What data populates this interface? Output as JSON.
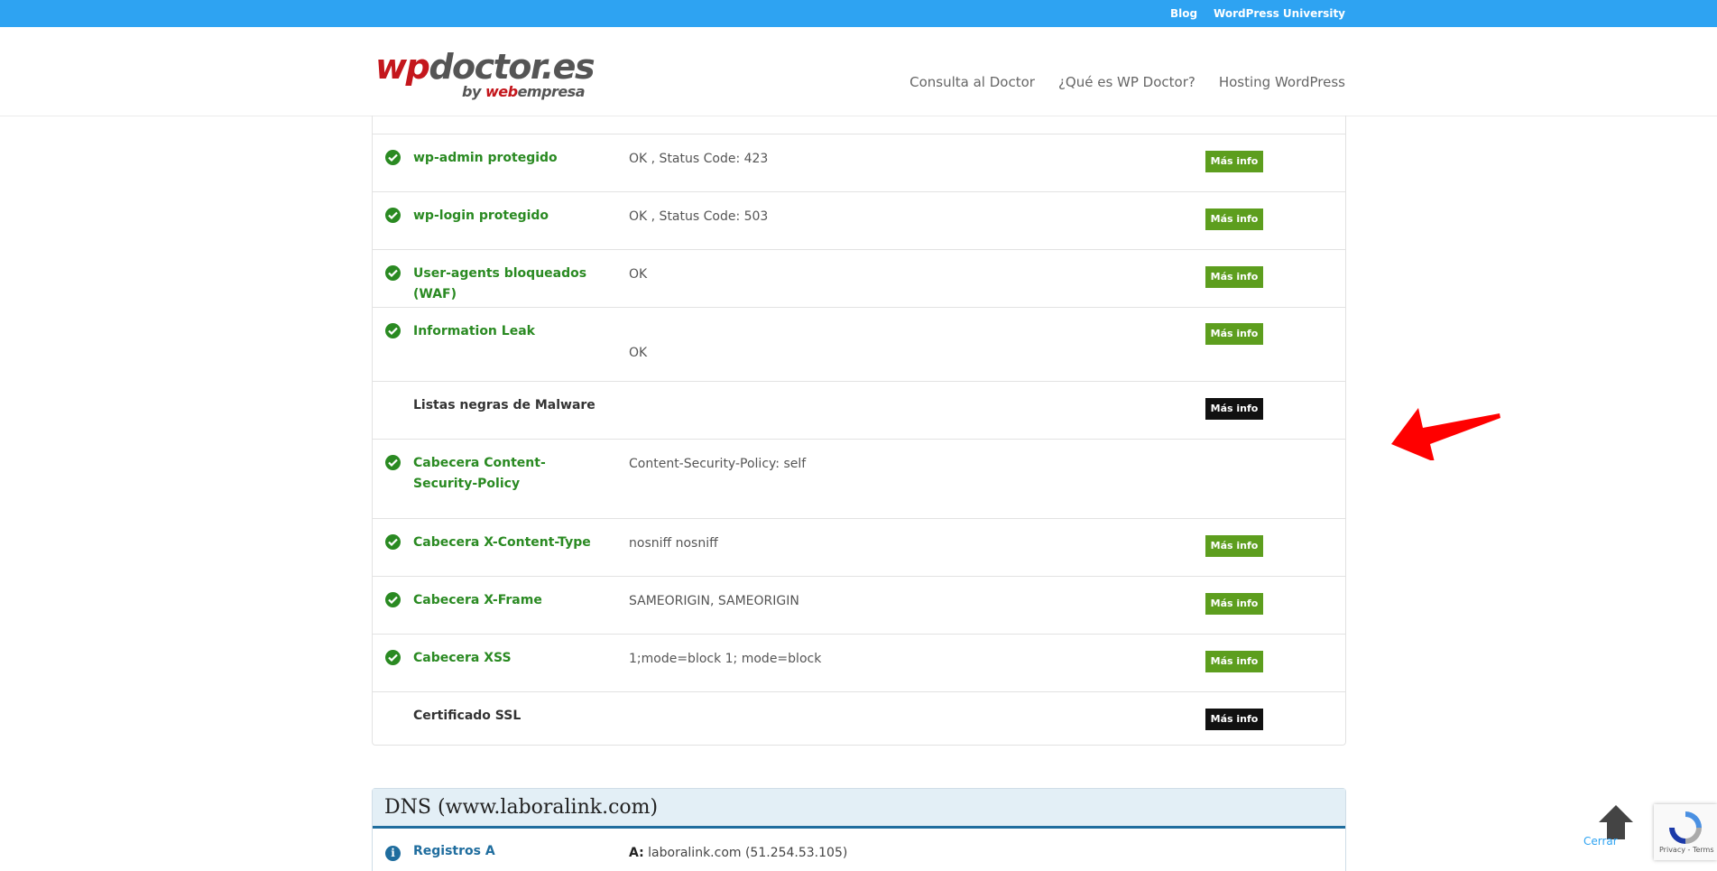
{
  "topbar": {
    "links": [
      "Blog",
      "WordPress University"
    ]
  },
  "logo": {
    "text_wp": "wp",
    "text_doctor": "doctor.es",
    "by": "by",
    "web": "web",
    "empresa": "empresa"
  },
  "nav": [
    "Consulta al Doctor",
    "¿Qué es WP Doctor?",
    "Hosting WordPress"
  ],
  "checks": [
    {
      "label": "wp-admin protegido",
      "status": "ok",
      "value": "OK , Status Code: 423",
      "button": "Más info"
    },
    {
      "label": "wp-login protegido",
      "status": "ok",
      "value": "OK , Status Code: 503",
      "button": "Más info"
    },
    {
      "label": "User-agents bloqueados (WAF)",
      "status": "ok",
      "value": "OK",
      "button": "Más info"
    },
    {
      "label": "Information Leak",
      "status": "ok",
      "value": "OK",
      "button": "Más info"
    },
    {
      "label": "Listas negras de Malware",
      "status": "none",
      "value": "",
      "button": "Más info"
    },
    {
      "label": "Cabecera Content-Security-Policy",
      "status": "ok",
      "value": "Content-Security-Policy: self",
      "button": ""
    },
    {
      "label": "Cabecera X-Content-Type",
      "status": "ok",
      "value": "nosniff nosniff",
      "button": "Más info"
    },
    {
      "label": "Cabecera X-Frame",
      "status": "ok",
      "value": "SAMEORIGIN, SAMEORIGIN",
      "button": "Más info"
    },
    {
      "label": "Cabecera XSS",
      "status": "ok",
      "value": "1;mode=block 1; mode=block",
      "button": "Más info"
    },
    {
      "label": "Certificado SSL",
      "status": "none",
      "value": "",
      "button": "Más info"
    }
  ],
  "dns": {
    "title": "DNS (www.laboralink.com)",
    "row_label": "Registros A",
    "row_key": "A:",
    "row_value": "laboralink.com (51.254.53.105)"
  },
  "footer": {
    "close_label": "Cerrar",
    "recaptcha_text": "Privacy - Terms"
  },
  "colors": {
    "topbar": "#2ea3f2",
    "ok_green": "#2a8a22",
    "button_green": "#5d9e1e",
    "button_black": "#111111",
    "dns_blue": "#1f6d9e",
    "arrow_red": "#ff0000"
  }
}
